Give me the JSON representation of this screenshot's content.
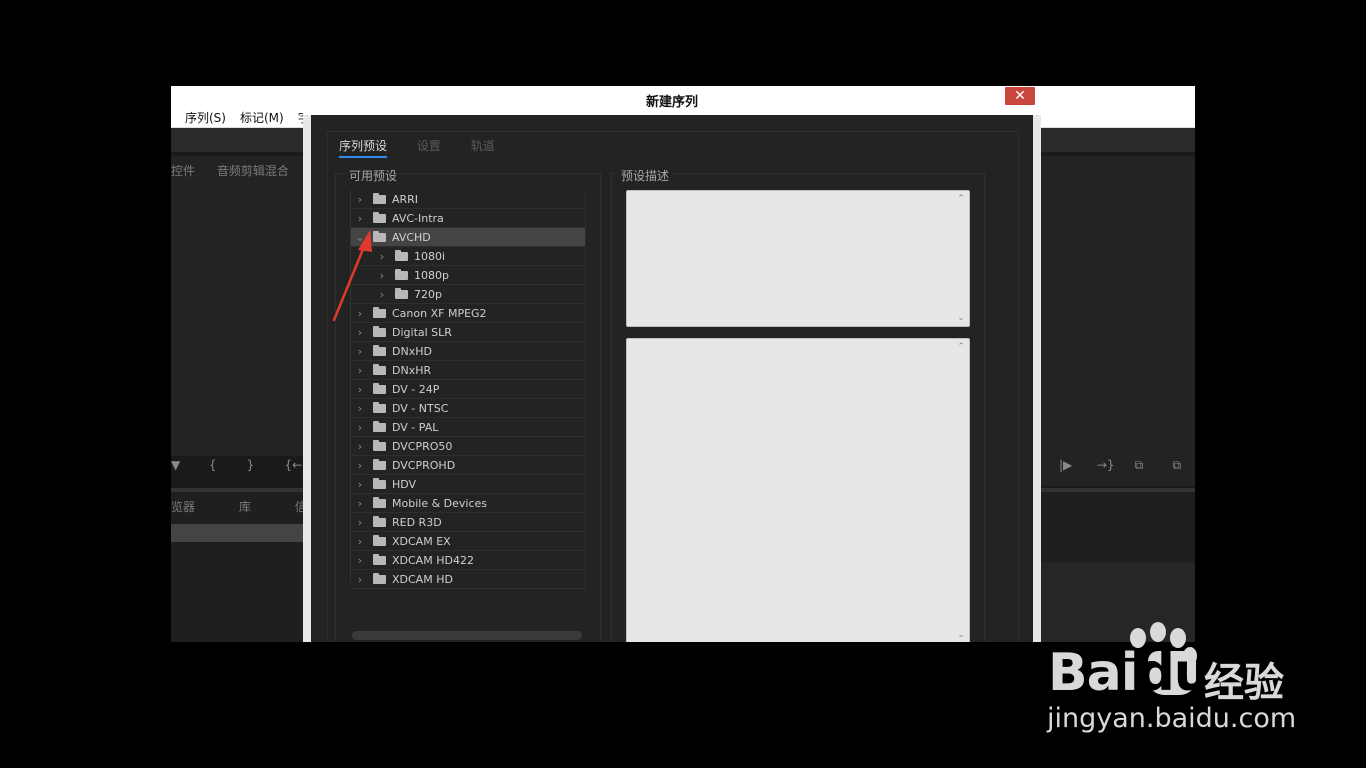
{
  "app": {
    "menu": [
      "序列(S)",
      "标记(M)",
      "字"
    ],
    "panel_tabs": [
      "控件",
      "音频剪辑混合"
    ],
    "transport_left": [
      "▼",
      "{",
      "}",
      "{←"
    ],
    "transport_right": [
      "|▶",
      "→}",
      "⧉",
      "⧉"
    ],
    "bottom_tabs": [
      "览器",
      "库",
      "信"
    ]
  },
  "dialog": {
    "title": "新建序列",
    "close_label": "✕",
    "tabs": [
      "序列预设",
      "设置",
      "轨道"
    ],
    "available_presets_title": "可用预设",
    "preset_description_title": "预设描述",
    "tree": [
      {
        "label": "ARRI",
        "level": 0,
        "expanded": false
      },
      {
        "label": "AVC-Intra",
        "level": 0,
        "expanded": false
      },
      {
        "label": "AVCHD",
        "level": 0,
        "expanded": true,
        "selected": true
      },
      {
        "label": "1080i",
        "level": 1,
        "expanded": false
      },
      {
        "label": "1080p",
        "level": 1,
        "expanded": false
      },
      {
        "label": "720p",
        "level": 1,
        "expanded": false
      },
      {
        "label": "Canon XF MPEG2",
        "level": 0,
        "expanded": false
      },
      {
        "label": "Digital SLR",
        "level": 0,
        "expanded": false
      },
      {
        "label": "DNxHD",
        "level": 0,
        "expanded": false
      },
      {
        "label": "DNxHR",
        "level": 0,
        "expanded": false
      },
      {
        "label": "DV - 24P",
        "level": 0,
        "expanded": false
      },
      {
        "label": "DV - NTSC",
        "level": 0,
        "expanded": false
      },
      {
        "label": "DV - PAL",
        "level": 0,
        "expanded": false
      },
      {
        "label": "DVCPRO50",
        "level": 0,
        "expanded": false
      },
      {
        "label": "DVCPROHD",
        "level": 0,
        "expanded": false
      },
      {
        "label": "HDV",
        "level": 0,
        "expanded": false
      },
      {
        "label": "Mobile & Devices",
        "level": 0,
        "expanded": false
      },
      {
        "label": "RED R3D",
        "level": 0,
        "expanded": false
      },
      {
        "label": "XDCAM EX",
        "level": 0,
        "expanded": false
      },
      {
        "label": "XDCAM HD422",
        "level": 0,
        "expanded": false
      },
      {
        "label": "XDCAM HD",
        "level": 0,
        "expanded": false
      }
    ]
  },
  "watermark": {
    "brand_left": "Bai",
    "brand_du": "du",
    "brand_right": "经验",
    "url": "jingyan.baidu.com"
  },
  "colors": {
    "accent": "#2d8ceb",
    "close": "#c9463d",
    "arrow": "#e03a2f"
  }
}
